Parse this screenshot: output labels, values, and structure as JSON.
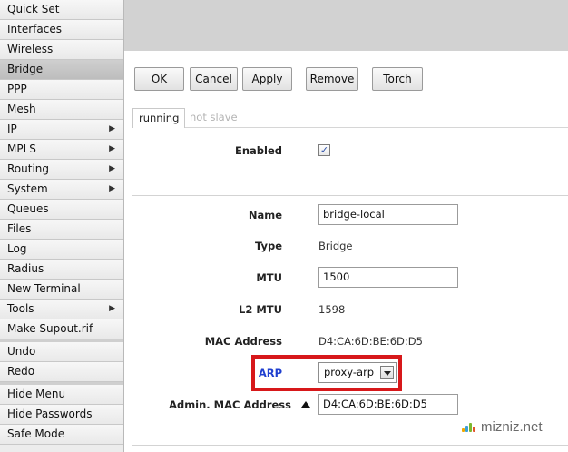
{
  "sidebar": {
    "groups": [
      [
        "Quick Set",
        "Interfaces",
        "Wireless",
        "Bridge",
        "PPP",
        "Mesh",
        "IP",
        "MPLS",
        "Routing",
        "System",
        "Queues",
        "Files",
        "Log",
        "Radius",
        "New Terminal",
        "Tools",
        "Make Supout.rif"
      ],
      [
        "Undo",
        "Redo"
      ],
      [
        "Hide Menu",
        "Hide Passwords",
        "Safe Mode"
      ]
    ],
    "active_item": "Bridge",
    "submenu_arrow": "▶"
  },
  "toolbar": {
    "ok": "OK",
    "cancel": "Cancel",
    "apply": "Apply",
    "remove": "Remove",
    "torch": "Torch"
  },
  "status": {
    "running": "running",
    "slave": "not slave"
  },
  "form": {
    "enabled_label": "Enabled",
    "enabled_mark": "✓",
    "name_label": "Name",
    "name_value": "bridge-local",
    "type_label": "Type",
    "type_value": "Bridge",
    "mtu_label": "MTU",
    "mtu_value": "1500",
    "l2mtu_label": "L2 MTU",
    "l2mtu_value": "1598",
    "mac_label": "MAC Address",
    "mac_value": "D4:CA:6D:BE:6D:D5",
    "arp_label": "ARP",
    "arp_value": "proxy-arp",
    "admin_mac_label": "Admin. MAC Address",
    "admin_mac_value": "D4:CA:6D:BE:6D:D5"
  },
  "watermark": {
    "text": "mizniz.net"
  },
  "colors": {
    "highlight": "#d7181a",
    "arp_label": "#1f3fcf"
  }
}
